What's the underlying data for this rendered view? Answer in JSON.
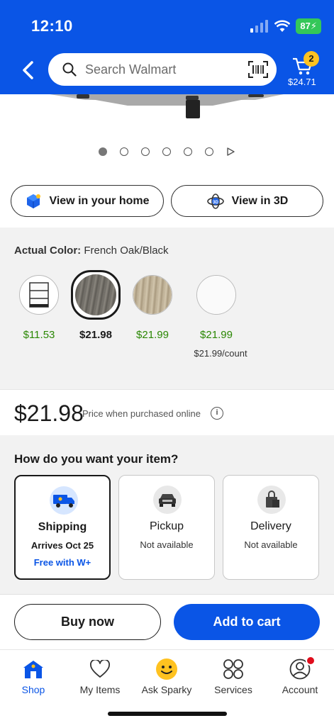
{
  "status": {
    "time": "12:10",
    "battery": "87"
  },
  "header": {
    "search_placeholder": "Search Walmart",
    "cart_count": "2",
    "cart_total": "$24.71"
  },
  "gallery": {
    "dot_count": 6,
    "active_index": 0
  },
  "view_buttons": {
    "home": "View in your home",
    "three_d": "View in 3D"
  },
  "color": {
    "label": "Actual Color:",
    "value": "French Oak/Black",
    "options": [
      {
        "price": "$11.53"
      },
      {
        "price": "$21.98",
        "selected": true
      },
      {
        "price": "$21.99"
      },
      {
        "price": "$21.99",
        "sub": "$21.99/count"
      }
    ]
  },
  "price": {
    "amount": "$21.98",
    "note": "Price when purchased online",
    "info": "i"
  },
  "fulfillment": {
    "title": "How do you want your item?",
    "options": [
      {
        "title": "Shipping",
        "status": "Arrives Oct 25",
        "extra": "Free with W+",
        "selected": true
      },
      {
        "title": "Pickup",
        "status": "Not available"
      },
      {
        "title": "Delivery",
        "status": "Not available"
      }
    ]
  },
  "actions": {
    "buy_now": "Buy now",
    "add_to_cart": "Add to cart"
  },
  "tabs": [
    {
      "label": "Shop",
      "icon": "shop-icon",
      "active": true
    },
    {
      "label": "My Items",
      "icon": "heart-icon"
    },
    {
      "label": "Ask Sparky",
      "icon": "sparky-icon"
    },
    {
      "label": "Services",
      "icon": "services-icon"
    },
    {
      "label": "Account",
      "icon": "account-icon",
      "badge": true
    }
  ],
  "colors": {
    "brand_blue": "#0a55e6",
    "price_green": "#2a8703",
    "spark_yellow": "#ffc220"
  }
}
